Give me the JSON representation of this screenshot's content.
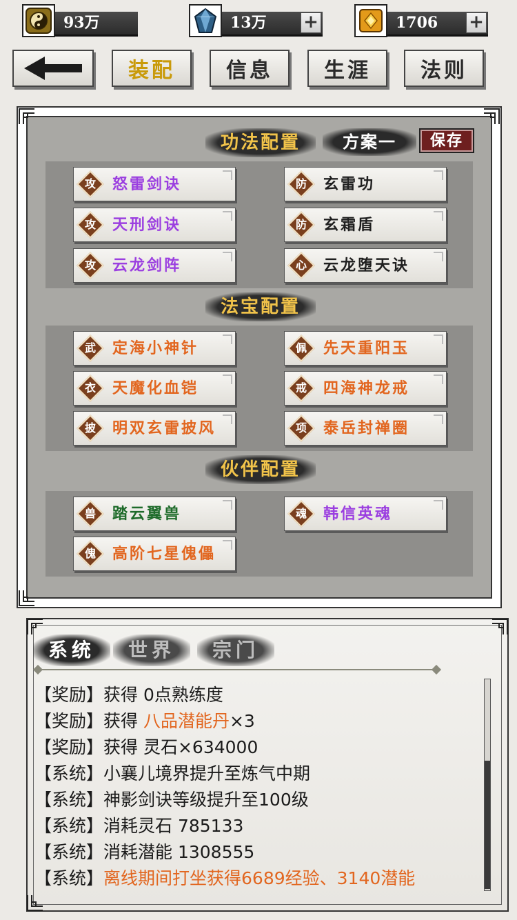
{
  "resources": [
    {
      "icon": "taiji-coin-icon",
      "value": "93万",
      "has_plus": false
    },
    {
      "icon": "spirit-crystal-icon",
      "value": "13万",
      "has_plus": true
    },
    {
      "icon": "gold-ingot-icon",
      "value": "1706",
      "has_plus": true
    }
  ],
  "nav": {
    "back_icon": "back-arrow-icon",
    "tabs": [
      {
        "label": "装配",
        "active": true
      },
      {
        "label": "信息",
        "active": false
      },
      {
        "label": "生涯",
        "active": false
      },
      {
        "label": "法则",
        "active": false
      }
    ]
  },
  "config": {
    "skills_title": "功法配置",
    "scheme_label": "方案一",
    "save_label": "保存",
    "skills": [
      {
        "tag": "攻",
        "name": "怒雷剑诀",
        "color": "purple"
      },
      {
        "tag": "防",
        "name": "玄雷功",
        "color": "black"
      },
      {
        "tag": "攻",
        "name": "天刑剑诀",
        "color": "purple"
      },
      {
        "tag": "防",
        "name": "玄霜盾",
        "color": "black"
      },
      {
        "tag": "攻",
        "name": "云龙剑阵",
        "color": "purple"
      },
      {
        "tag": "心",
        "name": "云龙堕天诀",
        "color": "black"
      }
    ],
    "treasure_title": "法宝配置",
    "treasures": [
      {
        "tag": "武",
        "name": "定海小神针",
        "color": "orange"
      },
      {
        "tag": "佩",
        "name": "先天重阳玉",
        "color": "orange"
      },
      {
        "tag": "衣",
        "name": "天魔化血铠",
        "color": "orange"
      },
      {
        "tag": "戒",
        "name": "四海神龙戒",
        "color": "orange"
      },
      {
        "tag": "披",
        "name": "明双玄雷披风",
        "color": "orange"
      },
      {
        "tag": "项",
        "name": "泰岳封禅圈",
        "color": "orange"
      }
    ],
    "partner_title": "伙伴配置",
    "partners": [
      {
        "tag": "兽",
        "name": "踏云翼兽",
        "color": "green"
      },
      {
        "tag": "魂",
        "name": "韩信英魂",
        "color": "purple"
      },
      {
        "tag": "傀",
        "name": "高阶七星傀儡",
        "color": "orange"
      }
    ]
  },
  "chat": {
    "tabs": [
      {
        "label": "系统",
        "active": true
      },
      {
        "label": "世界",
        "active": false
      },
      {
        "label": "宗门",
        "active": false
      }
    ],
    "messages": [
      {
        "prefix": "【奖励】",
        "text": "获得 0点熟练度",
        "highlight": "",
        "suffix": ""
      },
      {
        "prefix": "【奖励】",
        "text": "获得 ",
        "highlight": "八品潜能丹",
        "suffix": "×3"
      },
      {
        "prefix": "【奖励】",
        "text": "获得 灵石×634000",
        "highlight": "",
        "suffix": ""
      },
      {
        "prefix": "【系统】",
        "text": "小襄儿境界提升至炼气中期",
        "highlight": "",
        "suffix": ""
      },
      {
        "prefix": "【系统】",
        "text": "神影剑诀等级提升至100级",
        "highlight": "",
        "suffix": ""
      },
      {
        "prefix": "【系统】",
        "text": "消耗灵石 785133",
        "highlight": "",
        "suffix": ""
      },
      {
        "prefix": "【系统】",
        "text": "消耗潜能 1308555",
        "highlight": "",
        "suffix": ""
      },
      {
        "prefix": "【系统】",
        "text": "",
        "highlight": "离线期间打坐获得6689经验、3140潜能",
        "suffix": ""
      }
    ]
  }
}
